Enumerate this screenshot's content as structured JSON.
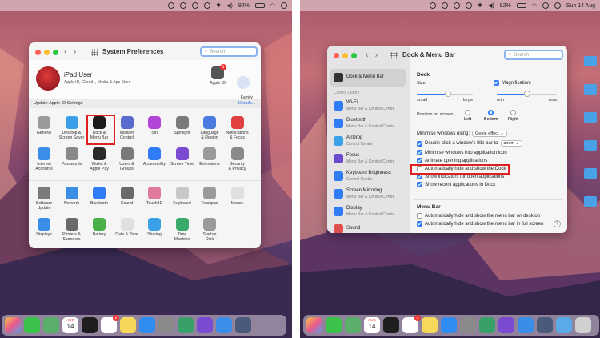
{
  "left": {
    "menubar": {
      "battery": "92%"
    },
    "window": {
      "title": "System Preferences",
      "search_placeholder": "Search",
      "user": {
        "name": "iPad User",
        "subtitle": "Apple ID, iCloud+, Media & App Store"
      },
      "apple_id_label": "Apple ID",
      "apple_id_badge": "1",
      "family_label": "Family\nSharing",
      "update_banner": "Update Apple ID Settings",
      "details_link": "Details...",
      "row1": [
        "General",
        "Desktop &\nScreen Saver",
        "Dock &\nMenu Bar",
        "Mission\nControl",
        "Siri",
        "Spotlight",
        "Language\n& Region",
        "Notifications\n& Focus"
      ],
      "row2": [
        "Internet\nAccounts",
        "Passwords",
        "Wallet &\nApple Pay",
        "Users &\nGroups",
        "Accessibility",
        "Screen Time",
        "Extensions",
        "Security\n& Privacy"
      ],
      "row3": [
        "Software\nUpdate",
        "Network",
        "Bluetooth",
        "Sound",
        "Touch ID",
        "Keyboard",
        "Trackpad",
        "Mouse"
      ],
      "row4": [
        "Displays",
        "Printers &\nScanners",
        "Battery",
        "Date & Time",
        "Sharing",
        "Time\nMachine",
        "Startup\nDisk"
      ]
    },
    "dock": {
      "calendar_month": "AUG",
      "calendar_day": "14",
      "reminders_badge": "2"
    }
  },
  "right": {
    "menubar": {
      "battery": "92%",
      "datetime": "Sun 14 Aug"
    },
    "window": {
      "title": "Dock & Menu Bar",
      "search_placeholder": "Search",
      "sidebar_top": "Dock & Menu Bar",
      "control_centre_label": "Control Centre",
      "sidebar": [
        {
          "title": "Wi-Fi",
          "sub": "Menu Bar & Control Centre"
        },
        {
          "title": "Bluetooth",
          "sub": "Menu Bar & Control Centre"
        },
        {
          "title": "AirDrop",
          "sub": "Control Centre"
        },
        {
          "title": "Focus",
          "sub": "Menu Bar & Control Centre"
        },
        {
          "title": "Keyboard Brightness",
          "sub": "Control Centre"
        },
        {
          "title": "Screen Mirroring",
          "sub": "Menu Bar & Control Centre"
        },
        {
          "title": "Display",
          "sub": "Menu Bar & Control Centre"
        },
        {
          "title": "Sound",
          "sub": ""
        }
      ],
      "dock_section": "Dock",
      "size_label": "Size:",
      "size_small": "small",
      "size_large": "large",
      "magnification_label": "Magnification:",
      "mag_min": "min",
      "mag_max": "max",
      "size_level": 0.55,
      "mag_level": 0.5,
      "position_label": "Position on screen:",
      "positions": [
        "Left",
        "Bottom",
        "Right"
      ],
      "minimise_label": "Minimise windows using:",
      "minimise_value": "Genie effect",
      "double_click_label": "Double-click a window's title bar to",
      "double_click_value": "zoom",
      "options": [
        {
          "label": "Minimise windows into application icon",
          "checked": true
        },
        {
          "label": "Animate opening applications",
          "checked": true
        },
        {
          "label": "Automatically hide and show the Dock",
          "checked": false
        },
        {
          "label": "Show indicators for open applications",
          "checked": true
        },
        {
          "label": "Show recent applications in Dock",
          "checked": true
        }
      ],
      "menubar_section": "Menu Bar",
      "menubar_options": [
        {
          "label": "Automatically hide and show the menu bar on desktop",
          "checked": false
        },
        {
          "label": "Automatically hide and show the menu bar in full screen",
          "checked": true
        }
      ],
      "help": "?"
    },
    "dock": {
      "calendar_month": "AUG",
      "calendar_day": "14",
      "reminders_badge": "2"
    }
  }
}
